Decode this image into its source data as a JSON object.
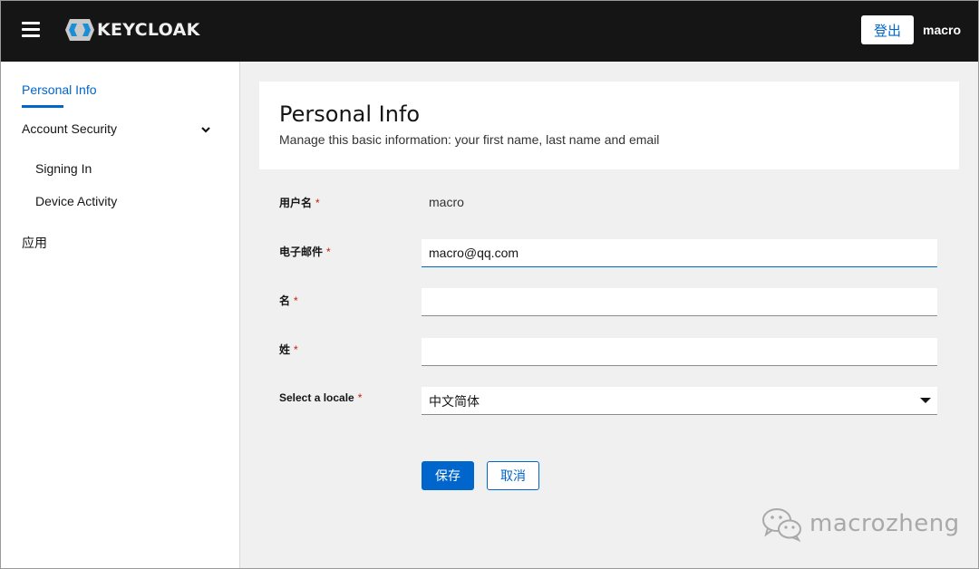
{
  "header": {
    "brand": "KEYCLOAK",
    "logout_label": "登出",
    "username": "macro"
  },
  "sidebar": {
    "items": [
      {
        "label": "Personal Info",
        "active": true
      },
      {
        "label": "Account Security",
        "expanded": true
      },
      {
        "label": "Signing In"
      },
      {
        "label": "Device Activity"
      },
      {
        "label": "应用"
      }
    ]
  },
  "page": {
    "title": "Personal Info",
    "description": "Manage this basic information: your first name, last name and email"
  },
  "form": {
    "username": {
      "label": "用户名",
      "value": "macro",
      "required": "*"
    },
    "email": {
      "label": "电子邮件",
      "value": "macro@qq.com",
      "required": "*"
    },
    "first_name": {
      "label": "名",
      "value": "",
      "required": "*"
    },
    "last_name": {
      "label": "姓",
      "value": "",
      "required": "*"
    },
    "locale": {
      "label": "Select a locale",
      "value": "中文简体",
      "required": "*"
    },
    "save_label": "保存",
    "cancel_label": "取消"
  },
  "watermark": {
    "text": "macrozheng"
  },
  "colors": {
    "header_bg": "#151515",
    "accent": "#0066cc",
    "required": "#c9190b",
    "main_bg": "#f0f0f0"
  }
}
